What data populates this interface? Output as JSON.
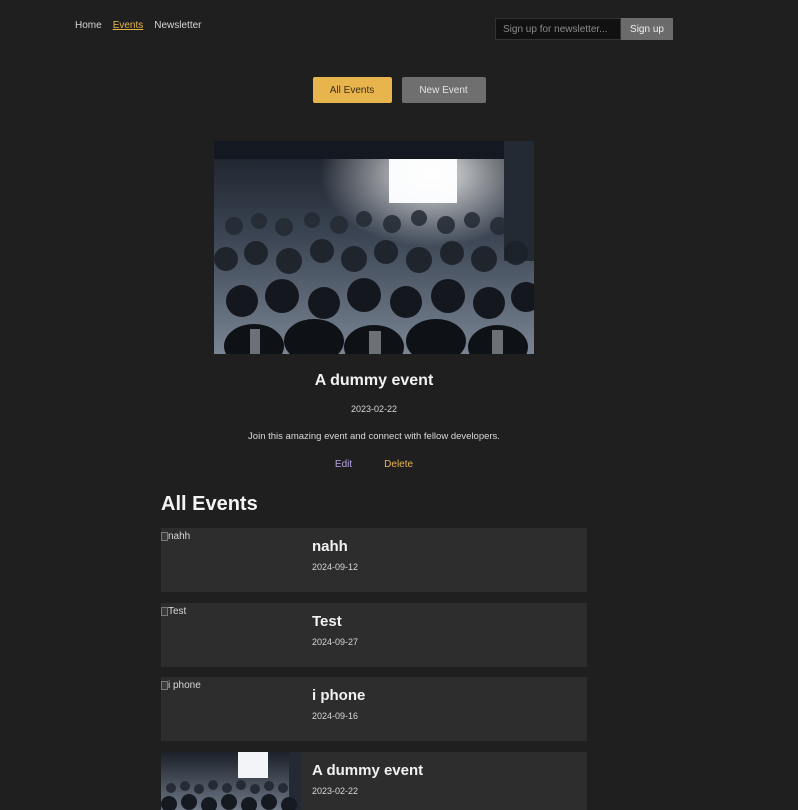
{
  "nav": {
    "items": [
      {
        "label": "Home",
        "active": false
      },
      {
        "label": "Events",
        "active": true
      },
      {
        "label": "Newsletter",
        "active": false
      }
    ]
  },
  "newsletter": {
    "placeholder": "Sign up for newsletter...",
    "button_label": "Sign up"
  },
  "tabs": {
    "all_events": "All Events",
    "new_event": "New Event"
  },
  "featured": {
    "image_alt": "A dummy event",
    "title": "A dummy event",
    "date": "2023-02-22",
    "description": "Join this amazing event and connect with fellow developers.",
    "edit_label": "Edit",
    "delete_label": "Delete"
  },
  "events_section": {
    "title": "All Events",
    "items": [
      {
        "image_alt": "nahh",
        "title": "nahh",
        "date": "2024-09-12",
        "has_image": false
      },
      {
        "image_alt": "Test",
        "title": "Test",
        "date": "2024-09-27",
        "has_image": false
      },
      {
        "image_alt": "i phone",
        "title": "i phone",
        "date": "2024-09-16",
        "has_image": false
      },
      {
        "image_alt": "A dummy event",
        "title": "A dummy event",
        "date": "2023-02-22",
        "has_image": true
      }
    ]
  },
  "colors": {
    "background": "#1f1f1f",
    "accent": "#e8b54d",
    "secondary_button": "#6f6f6f",
    "edit_link": "#b9a3e3",
    "card_background": "#2d2d2d"
  }
}
